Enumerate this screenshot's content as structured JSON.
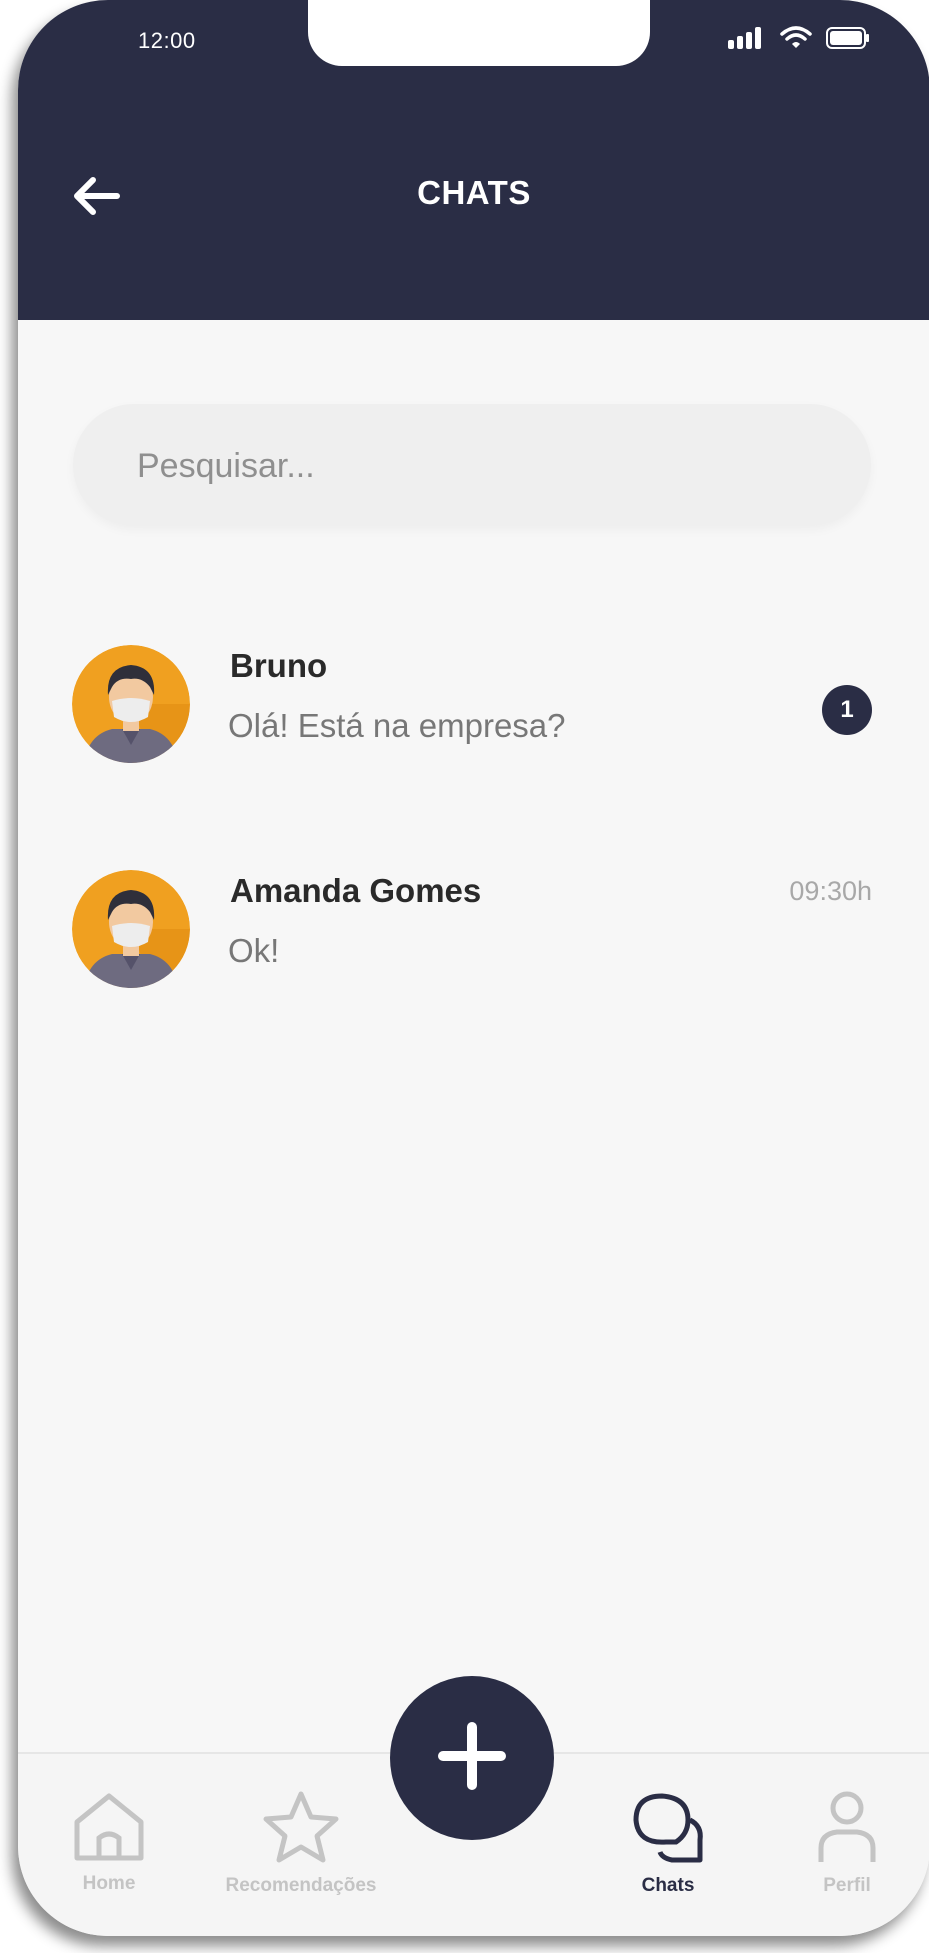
{
  "status_bar": {
    "time": "12:00"
  },
  "header": {
    "title": "CHATS",
    "back_icon": "arrow-left-icon"
  },
  "search": {
    "placeholder": "Pesquisar..."
  },
  "chats": [
    {
      "name": "Bruno",
      "last_message": "Olá! Está na empresa?",
      "time": "",
      "unread_count": "1"
    },
    {
      "name": "Amanda Gomes",
      "last_message": "Ok!",
      "time": "09:30h",
      "unread_count": ""
    }
  ],
  "fab": {
    "icon": "plus-icon"
  },
  "bottom_nav": {
    "items": [
      {
        "label": "Home",
        "icon": "home-icon",
        "active": false
      },
      {
        "label": "Recomendações",
        "icon": "star-icon",
        "active": false
      },
      {
        "label": "Chats",
        "icon": "chat-icon",
        "active": true
      },
      {
        "label": "Perfil",
        "icon": "user-icon",
        "active": false
      }
    ]
  },
  "colors": {
    "primary": "#2a2d45",
    "background": "#f7f7f7",
    "avatar_bg": "#f0a020",
    "inactive_nav": "#c4c4c4"
  }
}
